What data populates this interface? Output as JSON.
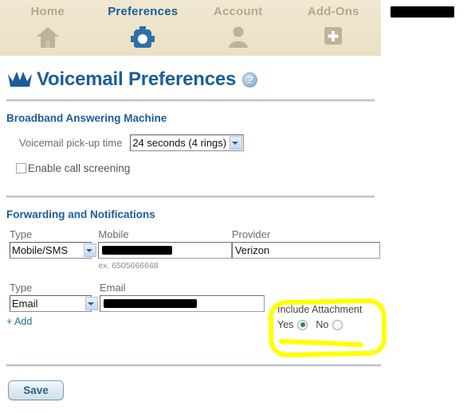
{
  "nav": {
    "items": [
      {
        "label": "Home",
        "icon": "house-icon",
        "active": false
      },
      {
        "label": "Preferences",
        "icon": "gear-icon",
        "active": true
      },
      {
        "label": "Account",
        "icon": "person-icon",
        "active": false
      },
      {
        "label": "Add-Ons",
        "icon": "plus-icon",
        "active": false
      }
    ]
  },
  "page": {
    "title": "Voicemail Preferences",
    "crown_icon": "crown-icon",
    "help_icon": "help-question-icon",
    "help_label": "?"
  },
  "answering_machine": {
    "section_title": "Broadband Answering Machine",
    "pickup_label": "Voicemail pick-up time",
    "pickup_value": "24 seconds (4 rings)",
    "pickup_options": [
      "24 seconds (4 rings)"
    ],
    "screening_label": "Enable call screening",
    "screening_checked": false
  },
  "forwarding": {
    "section_title": "Forwarding and Notifications",
    "rows": [
      {
        "type_label": "Type",
        "type_value": "Mobile/SMS",
        "type_options": [
          "Mobile/SMS"
        ],
        "value_label": "Mobile",
        "value_text": "",
        "value_redacted": true,
        "hint": "ex. 6505666668",
        "extra_label": "Provider",
        "extra_value": "Verizon"
      },
      {
        "type_label": "Type",
        "type_value": "Email",
        "type_options": [
          "Email"
        ],
        "value_label": "Email",
        "value_text": "",
        "value_redacted": true,
        "hint": "",
        "extra_label": "",
        "extra_value": ""
      }
    ],
    "add_link": "+ Add"
  },
  "include_attachment": {
    "title": "Include Attachment",
    "yes_label": "Yes",
    "no_label": "No",
    "selected": "Yes",
    "highlight_color": "#ffff00"
  },
  "footer": {
    "save_label": "Save"
  },
  "colors": {
    "nav_background": "#ede2c8",
    "nav_active_text": "#1c5d99",
    "nav_inactive_text": "#b3a88c",
    "heading_blue": "#1c5d99",
    "link_blue": "#2e6d93",
    "radio_selected": "#2f8a4e"
  }
}
